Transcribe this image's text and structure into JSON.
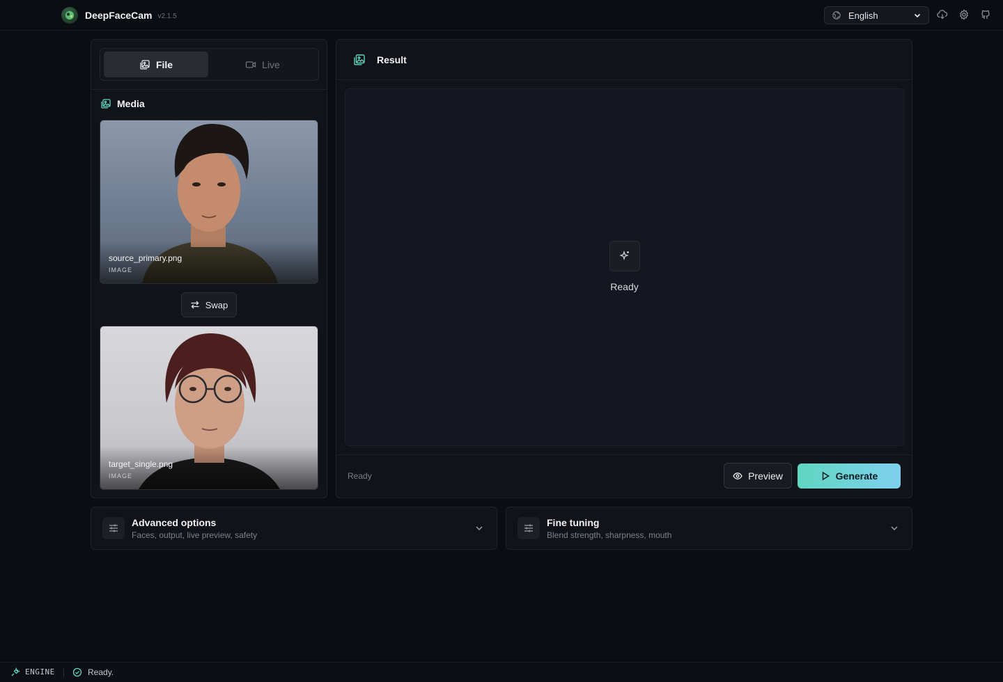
{
  "app": {
    "name": "DeepFaceCam",
    "version": "v2.1.5"
  },
  "header": {
    "language": "English"
  },
  "mode_tabs": [
    {
      "label": "File",
      "active": true
    },
    {
      "label": "Live",
      "active": false
    }
  ],
  "media": {
    "title": "Media",
    "source": {
      "filename": "source_primary.png",
      "type": "IMAGE"
    },
    "swap_label": "Swap",
    "target": {
      "filename": "target_single.png",
      "type": "IMAGE"
    }
  },
  "result": {
    "title": "Result",
    "placeholder": "Ready",
    "footer_status": "Ready",
    "preview_label": "Preview",
    "generate_label": "Generate"
  },
  "sections": [
    {
      "title": "Advanced options",
      "subtitle": "Faces, output, live preview, safety"
    },
    {
      "title": "Fine tuning",
      "subtitle": "Blend strength, sharpness, mouth"
    }
  ],
  "statusbar": {
    "engine": "ENGINE",
    "status": "Ready."
  },
  "colors": {
    "accent": "#5fd6c0",
    "accent_end": "#7fd0ee",
    "background": "#0c0d12",
    "panel": "#121319"
  }
}
